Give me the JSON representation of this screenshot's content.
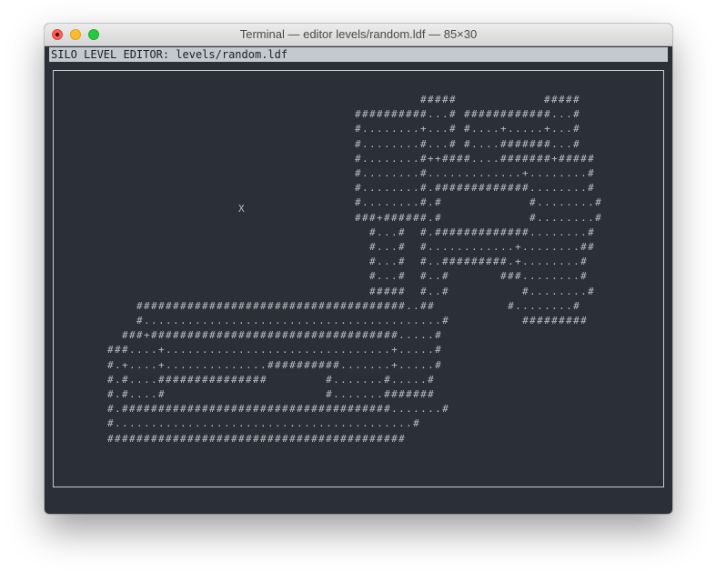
{
  "window": {
    "title": "Terminal — editor levels/random.ldf — 85×30"
  },
  "editor": {
    "status_line": "SILO LEVEL EDITOR: levels/random.ldf",
    "cursor": "X",
    "map_rows": [
      {
        "col": 50,
        "text": "#####            #####"
      },
      {
        "col": 41,
        "text": "##########...# ############...#"
      },
      {
        "col": 41,
        "text": "#........+...# #....+.....+...#"
      },
      {
        "col": 41,
        "text": "#........#...# #....#######...#"
      },
      {
        "col": 41,
        "text": "#........#++####....#######+#####"
      },
      {
        "col": 41,
        "text": "#........#.............+........#"
      },
      {
        "col": 41,
        "text": "#........#.#############........#"
      },
      {
        "col": 41,
        "text": "#........#.#            #........#"
      },
      {
        "col": 41,
        "text": "###+######.#            #........#"
      },
      {
        "col": 43,
        "text": "#...#  #.#############........#"
      },
      {
        "col": 43,
        "text": "#...#  #............+........##"
      },
      {
        "col": 43,
        "text": "#...#  #..#########.+........#"
      },
      {
        "col": 43,
        "text": "#...#  #..#       ###........#"
      },
      {
        "col": 43,
        "text": "#####  #..#          #........#"
      },
      {
        "col": 11,
        "text": "#####################################..##          #........#"
      },
      {
        "col": 11,
        "text": "#.........................................#          #########"
      },
      {
        "col": 9,
        "text": "###+##################################.....#"
      },
      {
        "col": 7,
        "text": "###....+...............................+.....#"
      },
      {
        "col": 7,
        "text": "#.+....+..............##########.......+.....#"
      },
      {
        "col": 7,
        "text": "#.#....###############        #.......#.....#"
      },
      {
        "col": 7,
        "text": "#.#....#                      #.......#######"
      },
      {
        "col": 7,
        "text": "#.#####################################.......#"
      },
      {
        "col": 7,
        "text": "#.........................................#"
      },
      {
        "col": 7,
        "text": "#########################################"
      }
    ]
  }
}
